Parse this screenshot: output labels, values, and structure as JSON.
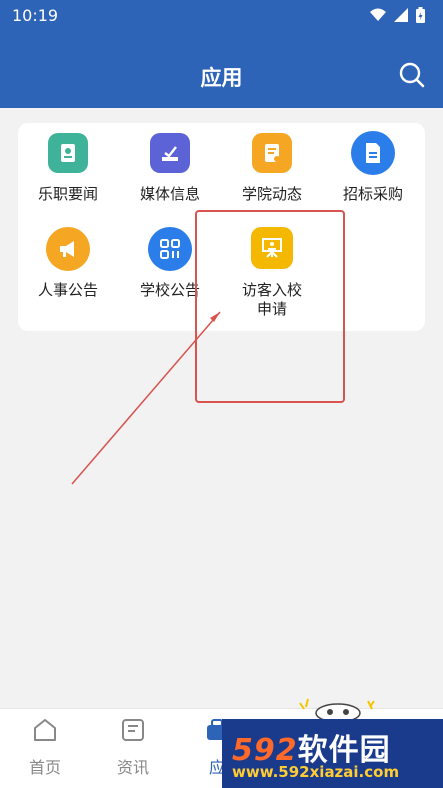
{
  "status": {
    "time": "10:19"
  },
  "header": {
    "title": "应用"
  },
  "apps": [
    {
      "label": "乐职要闻",
      "color": "#3fb39a",
      "icon": "job-news-icon"
    },
    {
      "label": "媒体信息",
      "color": "#5b63d6",
      "icon": "media-icon"
    },
    {
      "label": "学院动态",
      "color": "#f5a623",
      "icon": "college-news-icon"
    },
    {
      "label": "招标采购",
      "color": "#2b7de9",
      "icon": "procurement-icon"
    },
    {
      "label": "人事公告",
      "color": "#f5a623",
      "icon": "megaphone-icon"
    },
    {
      "label": "学校公告",
      "color": "#2b7de9",
      "icon": "qr-grid-icon"
    },
    {
      "label": "访客入校\n申请",
      "label_line1": "访客入校",
      "label_line2": "申请",
      "color": "#f5b800",
      "icon": "visitor-easel-icon"
    }
  ],
  "bottom_nav": [
    {
      "label": "首页",
      "icon": "home-icon",
      "active": false
    },
    {
      "label": "资讯",
      "icon": "news-icon",
      "active": false
    },
    {
      "label": "应",
      "icon": "apps-icon",
      "active": true
    }
  ],
  "watermark": {
    "brand": "592软件园",
    "brand_num": "592",
    "brand_text": "软件园",
    "url": "www.592xiazai.com"
  },
  "annotation": {
    "color": "#d9534f"
  }
}
